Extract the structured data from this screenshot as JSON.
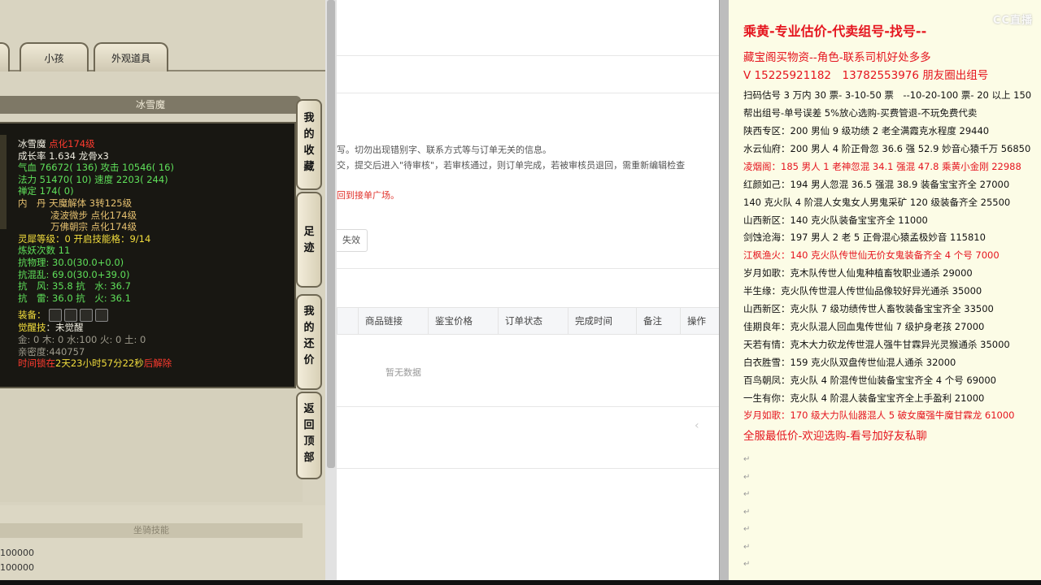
{
  "game": {
    "tabs": {
      "child": "小孩",
      "outfit": "外观道具"
    },
    "panel_title": "冰雪魔",
    "stats": {
      "name": "冰雪魔",
      "name_tag": "点化174级",
      "growth": "成长率 1.634 龙骨x3",
      "hp_label": "气血",
      "hp_val": "76672( 136)",
      "atk_label": "攻击",
      "atk_val": "10546( 16)",
      "mp_label": "法力",
      "mp_val": "51470( 10)",
      "spd_label": "速度",
      "spd_val": "2203( 244)",
      "ding": "禅定 174( 0)",
      "dan_label": "内　丹",
      "dan1": "天魔解体 3转125级",
      "dan2": "凌波微步 点化174级",
      "dan3": "万佛朝宗 点化174级",
      "linggu_label": "灵犀等级",
      "linggu_val": "：0 开启技能格：9/14",
      "lianyao": "炼妖次数 11",
      "kang1": "抗物理: 30.0(30.0+0.0)",
      "kang2": "抗混乱: 69.0(30.0+39.0)",
      "kang3": "抗　风: 35.8 抗　水: 36.7",
      "kang4": "抗　雷: 36.0 抗　火: 36.1",
      "equip_label": "装备：",
      "awaken_label": "觉醒技",
      "awaken_val": "：未觉醒",
      "elements": "金: 0 木: 0 水:100 火: 0 土: 0",
      "qinmi": "亲密度:440757",
      "timer_prefix": "时间锁在",
      "timer_val": "2天23小时57分22秒",
      "timer_suffix": "后解除"
    },
    "side_buttons": {
      "fav": [
        "我",
        "的",
        "收",
        "藏"
      ],
      "trace": [
        "足",
        "迹"
      ],
      "bargain": [
        "我",
        "的",
        "还",
        "价"
      ],
      "top": [
        "返",
        "回",
        "顶",
        "部"
      ]
    },
    "mount": {
      "header": "坐骑技能",
      "val1": "100000",
      "val2": "100000"
    }
  },
  "web": {
    "notice1": "写。切勿出现错别字、联系方式等与订单无关的信息。",
    "notice2": "交，提交后进入\"待审核\"，若审核通过，则订单完成，若被审核员退回，需重新编辑检查",
    "notice3": "回到接单广场。",
    "void_button": "失效",
    "columns": [
      "商品链接",
      "鉴宝价格",
      "订单状态",
      "完成时间",
      "备注",
      "操作"
    ],
    "empty": "暂无数据",
    "pager_prev": "‹"
  },
  "notes": {
    "logo": "CC直播",
    "title": "乘黄-专业估价-代卖组号-找号--",
    "line1": "藏宝阁买物资--角色-联系司机好处多多",
    "line2": "V 15225921182　13782553976 朋友圈出组号",
    "line3": "扫码估号 3 万内 30 票- 3-10-50 票　--10-20-100 票- 20 以上 150",
    "line4": "帮出组号-单号误差 5%放心选购-买费管退-不玩免费代卖",
    "listings": [
      {
        "text": "陕西专区：200 男仙 9 级功绩 2 老全满霞克水程度 29440",
        "red": false
      },
      {
        "text": "水云仙府：200 男人 4 阶正骨忽 36.6 强 52.9 妙音心猿千万 56850",
        "red": false
      },
      {
        "text": "凌烟阁：185 男人 1 老神忽混 34.1 强混 47.8 乘黄小金刚 22988",
        "red": true
      },
      {
        "text": "红颜如己：194 男人忽混 36.5 强混 38.9 装备宝宝齐全 27000",
        "red": false
      },
      {
        "text": "140 克火队 4 阶混人女鬼女人男鬼采矿 120 级装备齐全 25500",
        "red": false
      },
      {
        "text": "山西新区：140 克火队装备宝宝齐全 11000",
        "red": false
      },
      {
        "text": "剑蚀沧海：197 男人 2 老 5 正骨混心猿孟极妙音 115810",
        "red": false
      },
      {
        "text": "江枫渔火：140 克火队传世仙无价女鬼装备齐全 4 个号 7000",
        "red": true
      },
      {
        "text": "岁月如歌：克木队传世人仙鬼种植畜牧职业通杀 29000",
        "red": false
      },
      {
        "text": "半生缘：克火队传世混人传世仙品像较好异光通杀 35000",
        "red": false
      },
      {
        "text": "山西新区：克火队 7 级功绩传世人畜牧装备宝宝齐全 33500",
        "red": false
      },
      {
        "text": "佳期良年：克火队混人回血鬼传世仙 7 级护身老孩 27000",
        "red": false
      },
      {
        "text": "天若有情：克木大力砍龙传世混人强牛甘霖异光灵猴通杀 35000",
        "red": false
      },
      {
        "text": "白衣胜雪：159 克火队双盘传世仙混人通杀 32000",
        "red": false
      },
      {
        "text": "百鸟朝凤：克火队 4 阶混传世仙装备宝宝齐全 4 个号 69000",
        "red": false
      },
      {
        "text": "一生有你：克火队 4 阶混人装备宝宝齐全上手盈利 21000",
        "red": false
      },
      {
        "text": "岁月如歌：170 级大力队仙器混人 5 破女魔强牛魔甘霖龙 61000",
        "red": true
      }
    ],
    "footer": "全服最低价-欢迎选购-看号加好友私聊",
    "para_mark": "↵"
  }
}
